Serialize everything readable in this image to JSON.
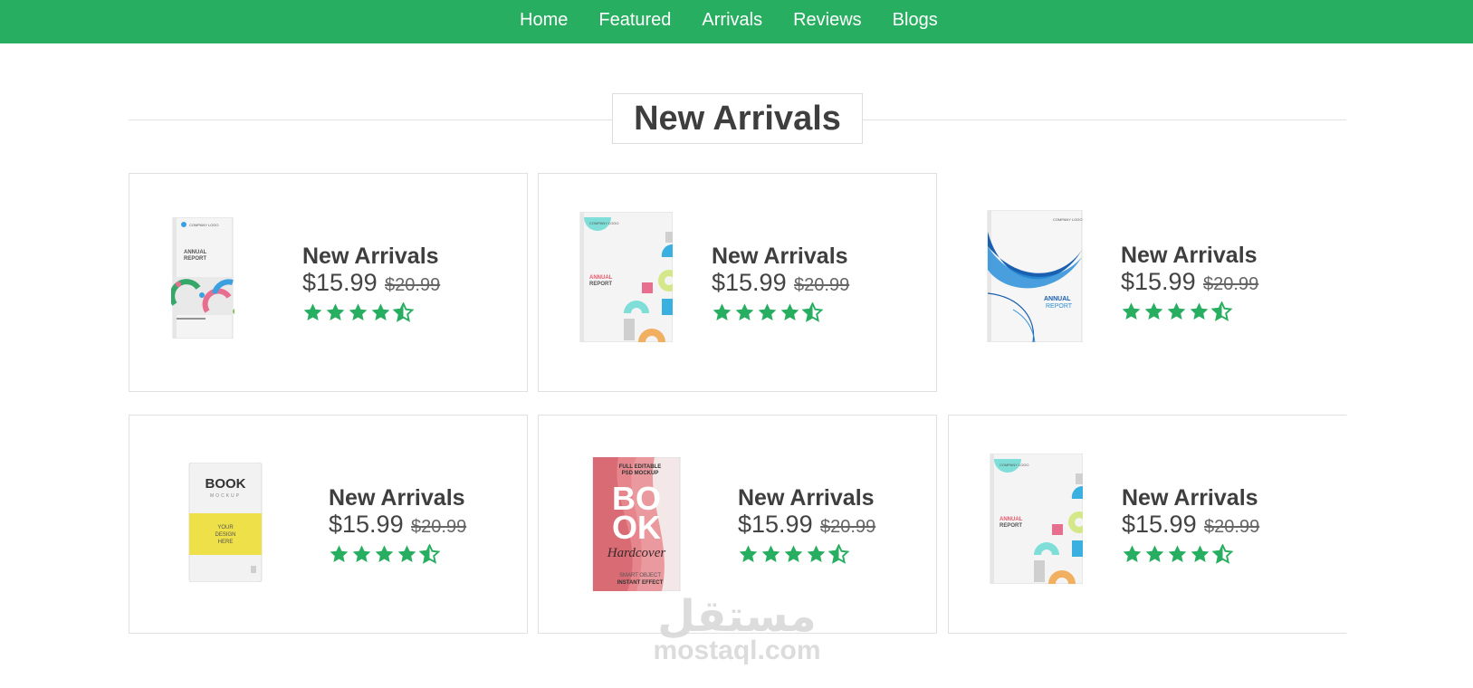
{
  "nav": {
    "items": [
      {
        "label": "Home"
      },
      {
        "label": "Featured"
      },
      {
        "label": "Arrivals"
      },
      {
        "label": "Reviews"
      },
      {
        "label": "Blogs"
      }
    ]
  },
  "section": {
    "heading": "New Arrivals"
  },
  "products": [
    {
      "title": "New Arrivals",
      "price": "$15.99",
      "old_price": "$20.99",
      "rating": 4.5,
      "cover": "annual-report-arcs"
    },
    {
      "title": "New Arrivals",
      "price": "$15.99",
      "old_price": "$20.99",
      "rating": 4.5,
      "cover": "annual-report-shapes"
    },
    {
      "title": "New Arrivals",
      "price": "$15.99",
      "old_price": "$20.99",
      "rating": 4.5,
      "cover": "annual-report-blue-waves"
    },
    {
      "title": "New Arrivals",
      "price": "$15.99",
      "old_price": "$20.99",
      "rating": 4.5,
      "cover": "book-mockup-yellow"
    },
    {
      "title": "New Arrivals",
      "price": "$15.99",
      "old_price": "$20.99",
      "rating": 4.5,
      "cover": "book-hardcover-red"
    },
    {
      "title": "New Arrivals",
      "price": "$15.99",
      "old_price": "$20.99",
      "rating": 4.5,
      "cover": "annual-report-shapes-2"
    }
  ],
  "covers": {
    "arcs": {
      "brand": "COMPANY LOGO",
      "line1": "ANNUAL",
      "line2": "REPORT"
    },
    "shapes": {
      "brand": "COMPANY LOGO",
      "line1": "ANNUAL",
      "line2": "REPORT"
    },
    "waves": {
      "brand": "COMPANY LOGO",
      "line1": "ANNUAL",
      "line2": "REPORT"
    },
    "mockup": {
      "title": "BOOK",
      "subtitle": "MOCKUP",
      "tag1": "YOUR",
      "tag2": "DESIGN",
      "tag3": "HERE"
    },
    "hardcover": {
      "top1": "FULL EDITABLE",
      "top2": "PSD MOCKUP",
      "big1": "BO",
      "big2": "OK",
      "script": "Hardcover",
      "bottom1": "SMART OBJECT",
      "bottom2": "INSTANT EFFECT"
    },
    "shapes2": {
      "brand": "COMPANY LOGO",
      "line1": "ANNUAL",
      "line2": "REPORT"
    }
  },
  "watermark": {
    "arabic": "مستقل",
    "latin": "mostaql.com"
  },
  "colors": {
    "accent": "#27ae60",
    "heading": "#3e3e3e",
    "border": "#e0e0e0"
  }
}
